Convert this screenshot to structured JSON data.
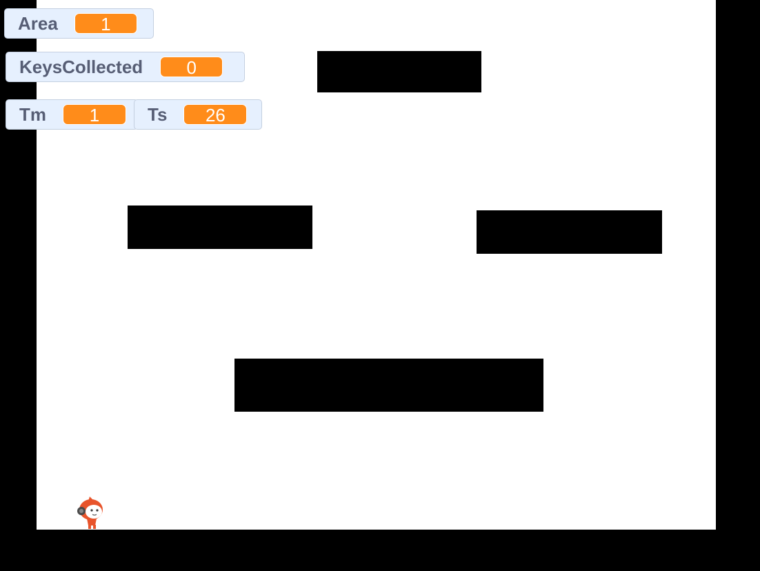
{
  "variables": {
    "area": {
      "label": "Area",
      "value": "1"
    },
    "keys": {
      "label": "KeysCollected",
      "value": "0"
    },
    "tm": {
      "label": "Tm",
      "value": "1"
    },
    "ts": {
      "label": "Ts",
      "value": "26"
    }
  },
  "colors": {
    "stage_background": "#ffffff",
    "border": "#000000",
    "platform": "#000000",
    "monitor_background": "#e6f0fe",
    "monitor_label": "#575e75",
    "monitor_value": "#ff8c1a",
    "sprite_primary": "#e8542b"
  },
  "sprite": {
    "icon": "player-character-icon"
  }
}
